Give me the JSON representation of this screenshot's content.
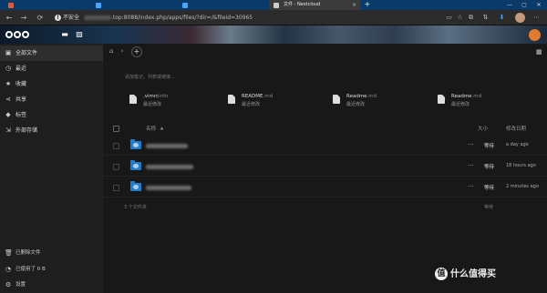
{
  "browser": {
    "tabs": [
      {
        "title": "",
        "fav_color": "#e05a3a"
      },
      {
        "title": "",
        "fav_color": "#4aa3ff"
      },
      {
        "title": "",
        "fav_color": "#4aa3ff"
      },
      {
        "title": "文件 - Nextcloud",
        "fav_color": "#cccccc"
      }
    ],
    "new_tab": "+",
    "window_controls": [
      "—",
      "▢",
      "✕"
    ],
    "back": "←",
    "forward": "→",
    "reload": "⟳",
    "insecure_label": "不安全",
    "url_text": ".top:8088/index.php/apps/files/?dir=/&fileid=30965"
  },
  "header": {
    "app_icons": [
      "folder-icon",
      "image-icon"
    ]
  },
  "sidebar": {
    "items": [
      {
        "label": "全部文件",
        "icon": "folder-icon",
        "glyph": "▣",
        "active": true
      },
      {
        "label": "最近",
        "icon": "clock-icon",
        "glyph": "◷",
        "active": false
      },
      {
        "label": "收藏",
        "icon": "star-icon",
        "glyph": "★",
        "active": false
      },
      {
        "label": "共享",
        "icon": "share-icon",
        "glyph": "⋖",
        "active": false
      },
      {
        "label": "标签",
        "icon": "tag-icon",
        "glyph": "◆",
        "active": false
      },
      {
        "label": "外部存储",
        "icon": "external-storage-icon",
        "glyph": "⇲",
        "active": false
      }
    ],
    "bottom": [
      {
        "label": "已删除文件",
        "icon": "trash-icon",
        "glyph": "🗑"
      },
      {
        "label": "已使用了 0 B",
        "icon": "pie-icon",
        "glyph": "◔"
      },
      {
        "label": "设置",
        "icon": "gear-icon",
        "glyph": "⚙"
      }
    ]
  },
  "main": {
    "breadcrumb_home": "⌂",
    "breadcrumb_sep": "›",
    "add_label": "+",
    "grid_toggle": "▦",
    "description_placeholder": "添加笔记，列表或链接...",
    "recent": [
      {
        "name": ".vimrc",
        "ext": "info",
        "sub": "最近修改"
      },
      {
        "name": "README",
        "ext": ".md",
        "sub": "最近修改"
      },
      {
        "name": "Readme",
        "ext": ".md",
        "sub": "最近修改"
      },
      {
        "name": "Readme",
        "ext": ".md",
        "sub": "最近修改"
      }
    ],
    "columns": {
      "name": "名称",
      "size": "大小",
      "modified": "修改日期"
    },
    "sort_indicator": "▲",
    "rows": [
      {
        "more": "···",
        "size": "等待",
        "modified": "a day ago"
      },
      {
        "more": "···",
        "size": "等待",
        "modified": "18 hours ago"
      },
      {
        "more": "···",
        "size": "等待",
        "modified": "2 minutes ago"
      }
    ],
    "summary": "3 个文件夹",
    "summary_size": "等待"
  },
  "watermark": {
    "glyph": "值",
    "text": "什么值得买"
  }
}
